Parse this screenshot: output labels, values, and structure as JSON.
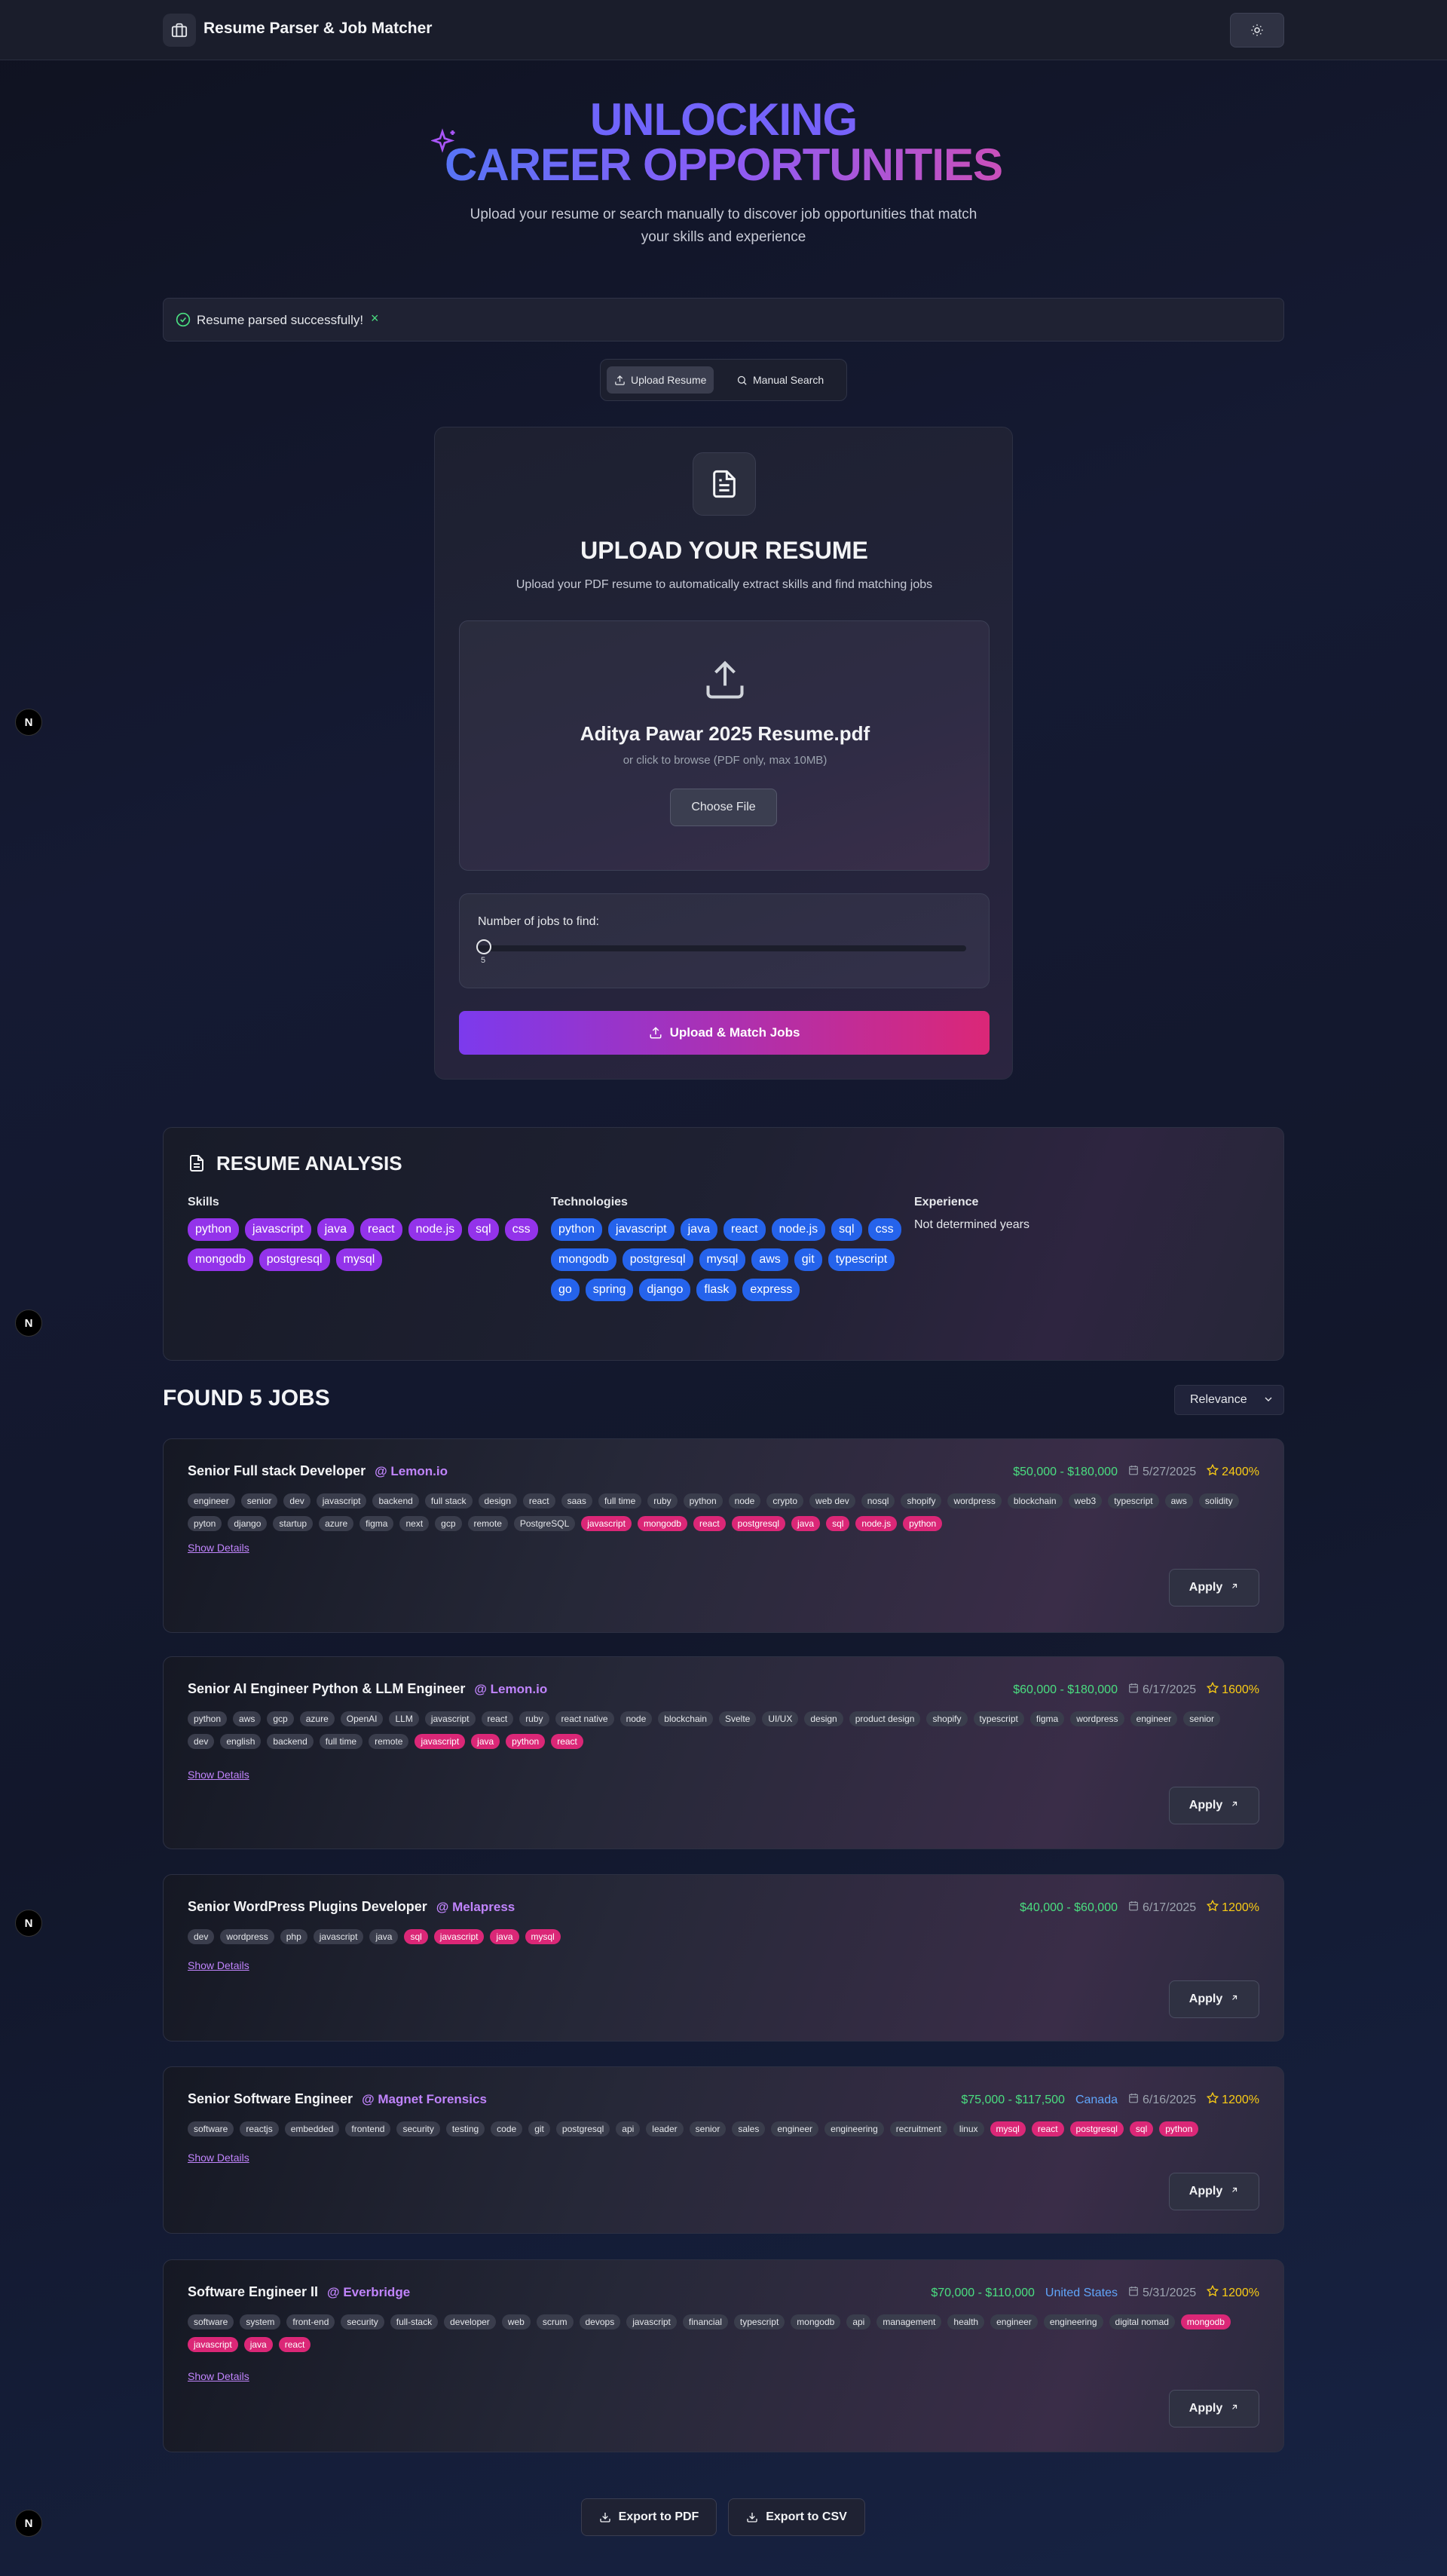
{
  "header": {
    "title": "Resume Parser & Job Matcher"
  },
  "hero": {
    "line1": "UNLOCKING",
    "line2": "CAREER OPPORTUNITIES",
    "subtitle": "Upload your resume or search manually to discover job opportunities that match your skills and experience"
  },
  "banner": {
    "message": "Resume parsed successfully!",
    "close": "×"
  },
  "tabs": [
    {
      "label": "Upload Resume"
    },
    {
      "label": "Manual Search"
    }
  ],
  "upload": {
    "title": "UPLOAD YOUR RESUME",
    "description": "Upload your PDF resume to automatically extract skills and find matching jobs",
    "file_name": "Aditya Pawar 2025 Resume.pdf",
    "hint": "or click to browse (PDF only, max 10MB)",
    "choose_label": "Choose File",
    "slider_label": "Number of jobs to find:",
    "slider_value": "5",
    "submit_label": "Upload & Match Jobs"
  },
  "analysis": {
    "title": "RESUME ANALYSIS",
    "skills_label": "Skills",
    "skills": [
      "python",
      "javascript",
      "java",
      "react",
      "node.js",
      "sql",
      "css",
      "mongodb",
      "postgresql",
      "mysql"
    ],
    "tech_label": "Technologies",
    "technologies": [
      "python",
      "javascript",
      "java",
      "react",
      "node.js",
      "sql",
      "css",
      "mongodb",
      "postgresql",
      "mysql",
      "aws",
      "git",
      "typescript",
      "go",
      "spring",
      "django",
      "flask",
      "express"
    ],
    "exp_label": "Experience",
    "experience": "Not determined years"
  },
  "results": {
    "title": "FOUND 5 JOBS",
    "sort": "Relevance"
  },
  "jobs": [
    {
      "title": "Senior Full stack Developer",
      "company": "@ Lemon.io",
      "salary": "$50,000 - $180,000",
      "location": "",
      "date": "5/27/2025",
      "score": "2400%",
      "tags": [
        "engineer",
        "senior",
        "dev",
        "javascript",
        "backend",
        "full stack",
        "design",
        "react",
        "saas",
        "full time",
        "ruby",
        "python",
        "node",
        "crypto",
        "web dev",
        "nosql",
        "shopify",
        "wordpress",
        "blockchain",
        "web3",
        "typescript",
        "aws",
        "solidity",
        "pyton",
        "django",
        "startup",
        "azure",
        "figma",
        "next",
        "gcp",
        "remote",
        "PostgreSQL"
      ],
      "matches": [
        "javascript",
        "mongodb",
        "react",
        "postgresql",
        "java",
        "sql",
        "node.js",
        "python"
      ],
      "show_details": "Show Details",
      "apply": "Apply"
    },
    {
      "title": "Senior AI Engineer Python & LLM Engineer",
      "company": "@ Lemon.io",
      "salary": "$60,000 - $180,000",
      "location": "",
      "date": "6/17/2025",
      "score": "1600%",
      "tags": [
        "python",
        "aws",
        "gcp",
        "azure",
        "OpenAI",
        "LLM",
        "javascript",
        "react",
        "ruby",
        "react native",
        "node",
        "blockchain",
        "Svelte",
        "UI/UX",
        "design",
        "product design",
        "shopify",
        "typescript",
        "figma",
        "wordpress",
        "engineer",
        "senior",
        "dev",
        "english",
        "backend",
        "full time",
        "remote"
      ],
      "matches": [
        "javascript",
        "java",
        "python",
        "react"
      ],
      "show_details": "Show Details",
      "apply": "Apply"
    },
    {
      "title": "Senior WordPress Plugins Developer",
      "company": "@ Melapress",
      "salary": "$40,000 - $60,000",
      "location": "",
      "date": "6/17/2025",
      "score": "1200%",
      "tags": [
        "dev",
        "wordpress",
        "php",
        "javascript",
        "java"
      ],
      "matches": [
        "sql",
        "javascript",
        "java",
        "mysql"
      ],
      "show_details": "Show Details",
      "apply": "Apply"
    },
    {
      "title": "Senior Software Engineer",
      "company": "@ Magnet Forensics",
      "salary": "$75,000 - $117,500",
      "location": "Canada",
      "date": "6/16/2025",
      "score": "1200%",
      "tags": [
        "software",
        "reactjs",
        "embedded",
        "frontend",
        "security",
        "testing",
        "code",
        "git",
        "postgresql",
        "api",
        "leader",
        "senior",
        "sales",
        "engineer",
        "engineering",
        "recruitment",
        "linux"
      ],
      "matches": [
        "mysql",
        "react",
        "postgresql",
        "sql",
        "python"
      ],
      "show_details": "Show Details",
      "apply": "Apply"
    },
    {
      "title": "Software Engineer II",
      "company": "@ Everbridge",
      "salary": "$70,000 - $110,000",
      "location": "United States",
      "date": "5/31/2025",
      "score": "1200%",
      "tags": [
        "software",
        "system",
        "front-end",
        "security",
        "full-stack",
        "developer",
        "web",
        "scrum",
        "devops",
        "javascript",
        "financial",
        "typescript",
        "mongodb",
        "api",
        "management",
        "health",
        "engineer",
        "engineering",
        "digital nomad"
      ],
      "matches": [
        "mongodb",
        "javascript",
        "java",
        "react"
      ],
      "show_details": "Show Details",
      "apply": "Apply"
    }
  ],
  "export": {
    "pdf": "Export to PDF",
    "csv": "Export to CSV"
  },
  "side_badge": "N",
  "colors": {
    "accent_purple": "#9333ea",
    "accent_blue": "#2563eb",
    "match_pink": "#db2777",
    "salary_green": "#4ade80",
    "score_yellow": "#facc15"
  }
}
